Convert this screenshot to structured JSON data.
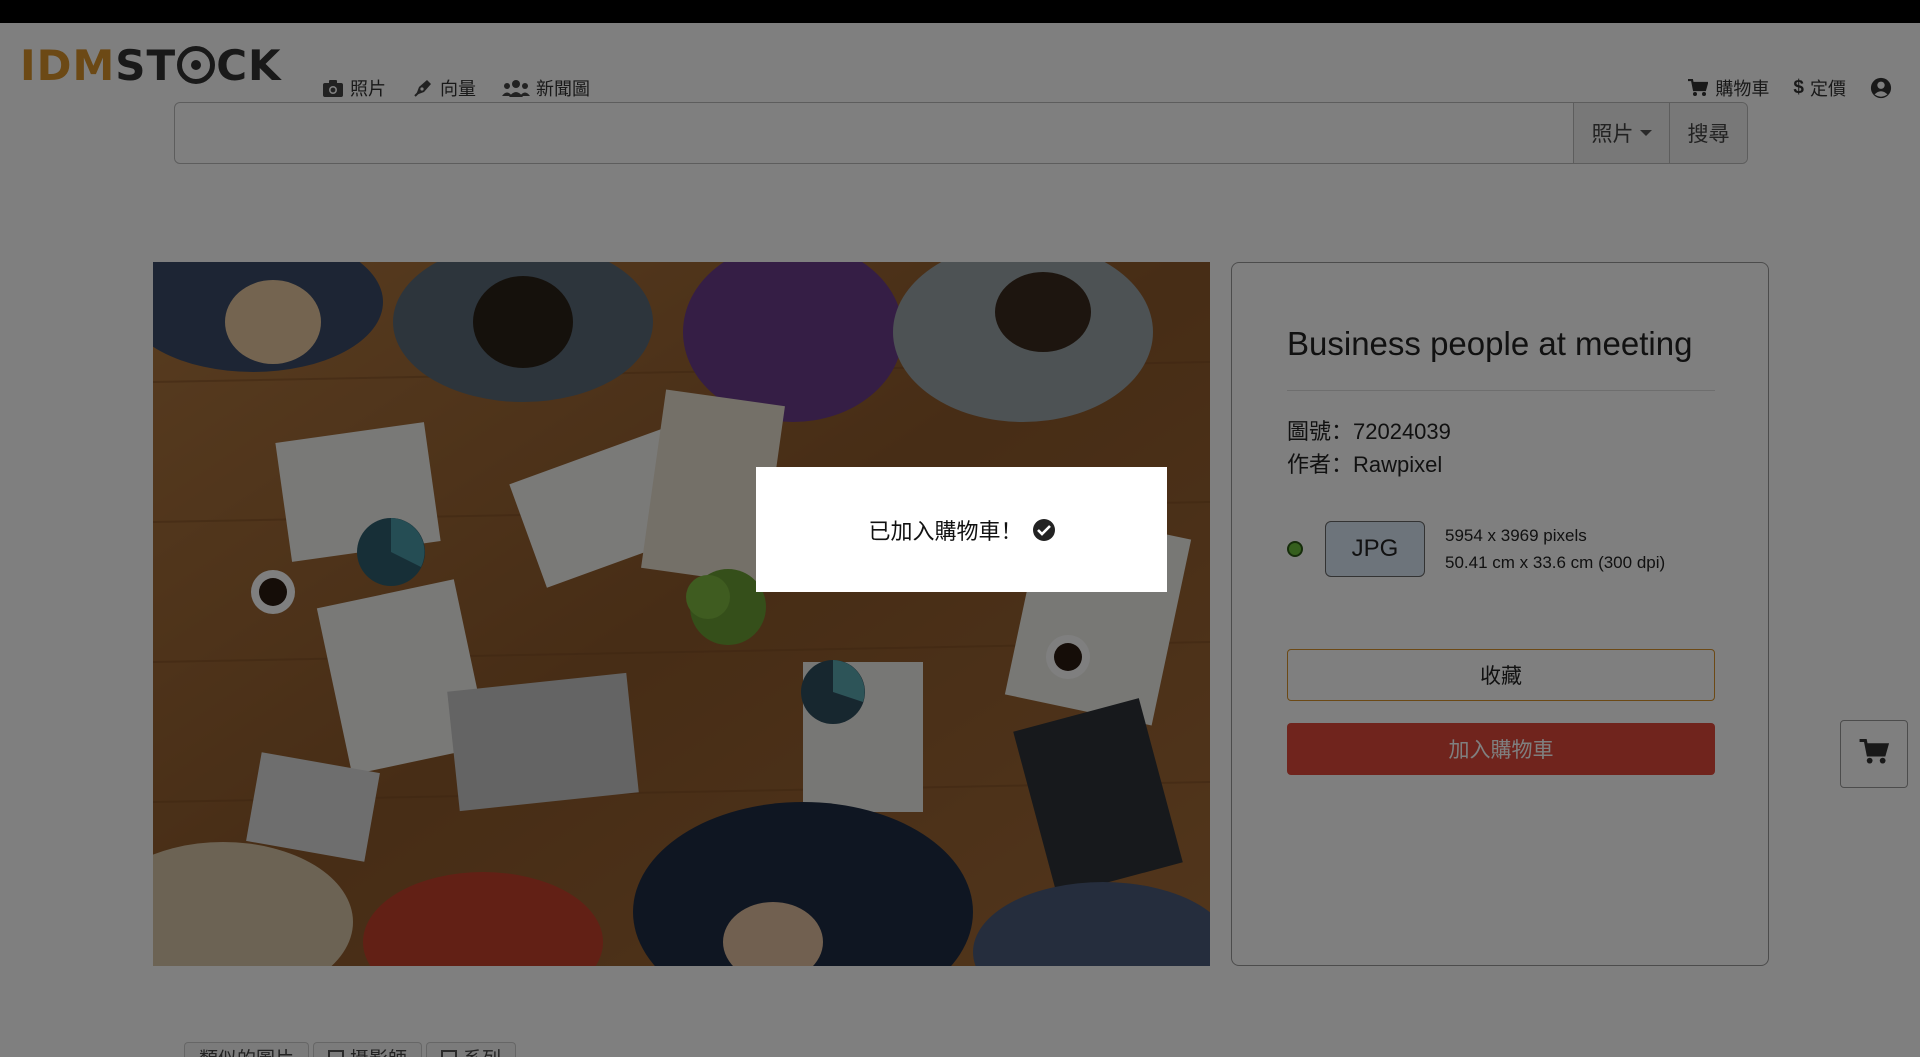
{
  "brand": {
    "part1": "IDM",
    "part2": "ST",
    "part3": "CK"
  },
  "nav": {
    "photos": "照片",
    "vectors": "向量",
    "news": "新聞圖",
    "cart": "購物車",
    "pricing": "定價"
  },
  "search": {
    "value": "",
    "placeholder": "",
    "type_label": "照片",
    "button_label": "搜尋"
  },
  "detail": {
    "title": "Business people at meeting",
    "image_id_line": "圖號：72024039",
    "author_line": "作者：Rawpixel",
    "format": "JPG",
    "pixels": "5954 x 3969 pixels",
    "print_size": "50.41 cm x 33.6 cm (300 dpi)",
    "favorite_label": "收藏",
    "add_to_cart_label": "加入購物車"
  },
  "tabs": [
    "類似的圖片",
    "攝影師",
    "系列"
  ],
  "modal": {
    "message": "已加入購物車！"
  },
  "colors": {
    "accent": "#d8922a",
    "cart_button": "#e0483a",
    "overlay": "rgba(0,0,0,0.5)"
  },
  "icons": [
    "camera-icon",
    "pen-icon",
    "users-icon",
    "cart-icon",
    "dollar-icon",
    "user-circle-icon",
    "check-circle-icon"
  ]
}
